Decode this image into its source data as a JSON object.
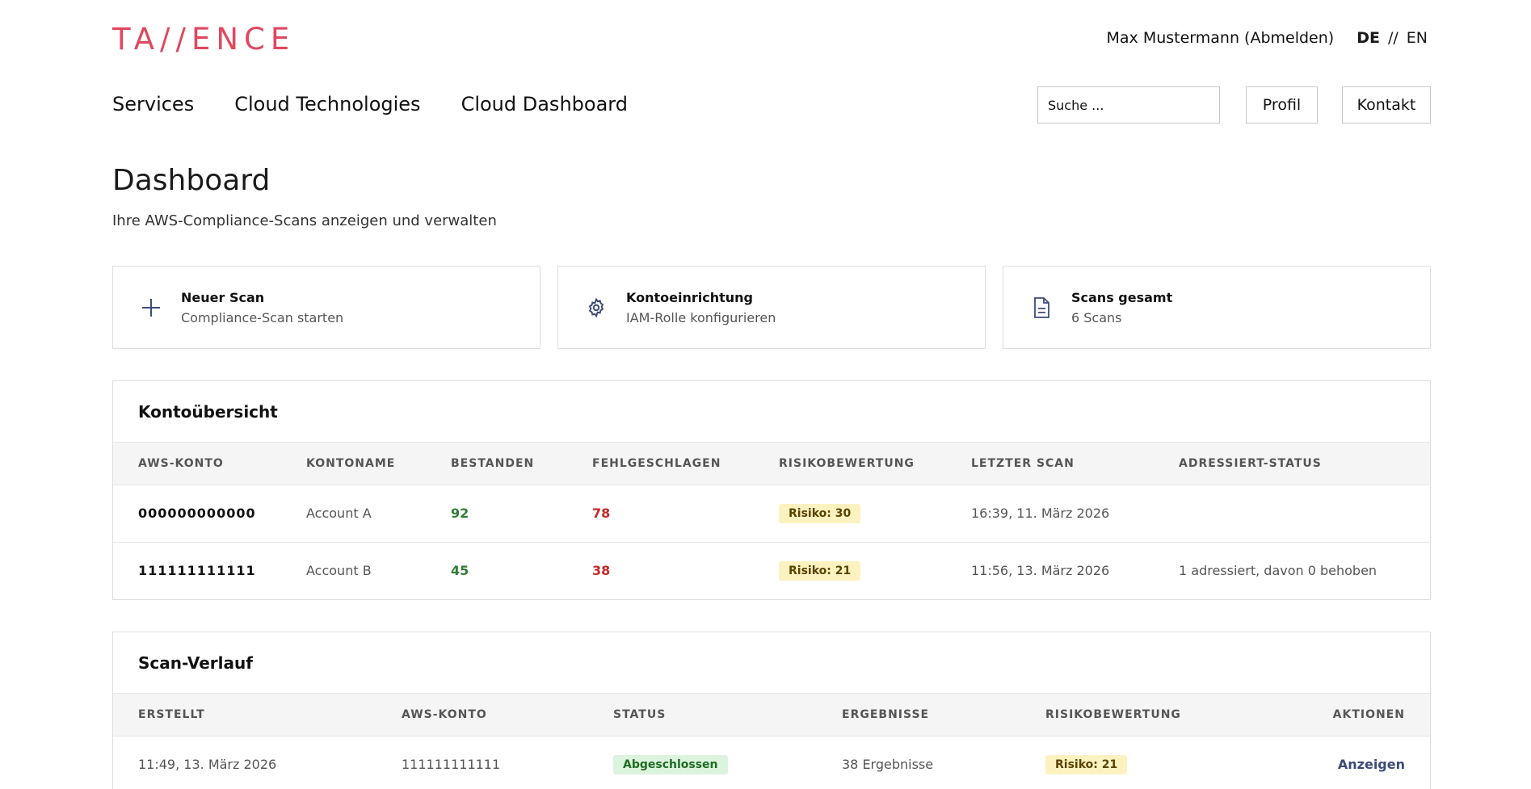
{
  "header": {
    "logo": "TA//ENCE",
    "user": "Max Mustermann (Abmelden)",
    "lang_active": "DE",
    "lang_sep": "//",
    "lang_other": "EN"
  },
  "nav": {
    "items": [
      "Services",
      "Cloud Technologies",
      "Cloud Dashboard"
    ],
    "search_placeholder": "Suche ...",
    "profil": "Profil",
    "kontakt": "Kontakt"
  },
  "page": {
    "title": "Dashboard",
    "subtitle": "Ihre AWS-Compliance-Scans anzeigen und verwalten"
  },
  "cards": [
    {
      "icon": "plus-icon",
      "title": "Neuer Scan",
      "desc": "Compliance-Scan starten"
    },
    {
      "icon": "gear-icon",
      "title": "Kontoeinrichtung",
      "desc": "IAM-Rolle konfigurieren"
    },
    {
      "icon": "document-icon",
      "title": "Scans gesamt",
      "desc": "6 Scans"
    }
  ],
  "overview": {
    "title": "Kontoübersicht",
    "columns": [
      "AWS-KONTO",
      "KONTONAME",
      "BESTANDEN",
      "FEHLGESCHLAGEN",
      "RISIKOBEWERTUNG",
      "LETZTER SCAN",
      "ADRESSIERT-STATUS"
    ],
    "rows": [
      {
        "account": "000000000000",
        "name": "Account A",
        "passed": "92",
        "failed": "78",
        "risk": "Risiko: 30",
        "last_scan": "16:39, 11. März 2026",
        "addressed": ""
      },
      {
        "account": "111111111111",
        "name": "Account B",
        "passed": "45",
        "failed": "38",
        "risk": "Risiko: 21",
        "last_scan": "11:56, 13. März 2026",
        "addressed": "1 adressiert, davon 0 behoben"
      }
    ]
  },
  "history": {
    "title": "Scan-Verlauf",
    "columns": [
      "ERSTELLT",
      "AWS-KONTO",
      "STATUS",
      "ERGEBNISSE",
      "RISIKOBEWERTUNG",
      "AKTIONEN"
    ],
    "rows": [
      {
        "created": "11:49, 13. März 2026",
        "account": "111111111111",
        "status": "Abgeschlossen",
        "results": "38 Ergebnisse",
        "risk": "Risiko: 21",
        "action": "Anzeigen"
      }
    ]
  },
  "colors": {
    "brand": "#e0485f",
    "accent": "#3d4b7a",
    "pass": "#2e7d32",
    "fail": "#c62828"
  }
}
